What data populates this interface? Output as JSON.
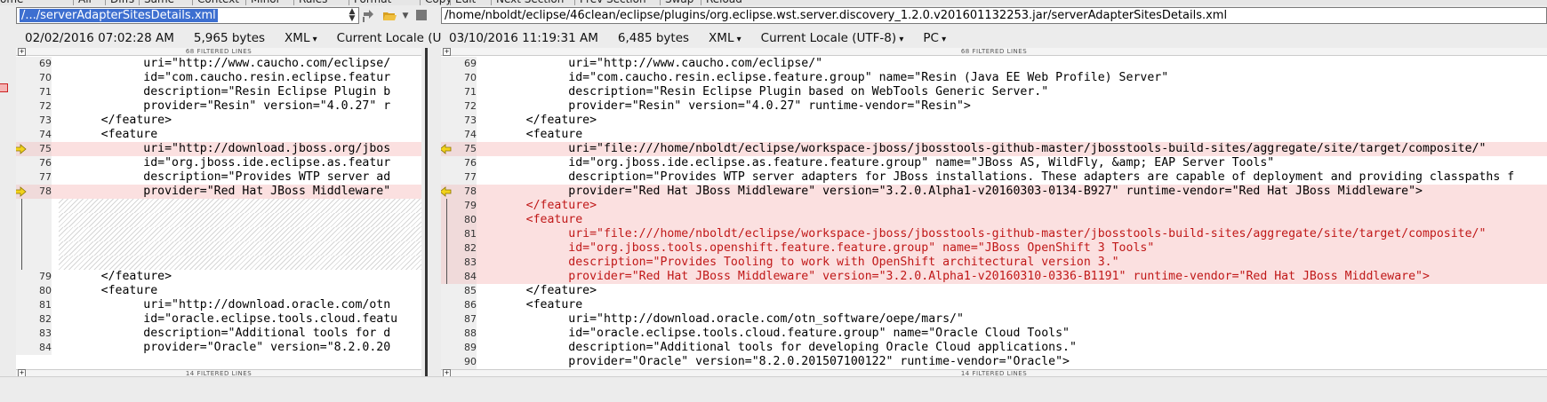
{
  "menubar": {
    "items": [
      "ome",
      "All",
      "Diffs",
      "Same",
      "Context",
      "Minor",
      "Rules",
      "Format",
      "Copy",
      "Edit",
      "Next Section",
      "Prev Section",
      "Swap",
      "Reload"
    ]
  },
  "toolbar": {
    "left_path": "/.../serverAdapterSitesDetails.xml",
    "right_path": "/home/nboldt/eclipse/46clean/eclipse/plugins/org.eclipse.wst.server.discovery_1.2.0.v201601132253.jar/serverAdapterSitesDetails.xml"
  },
  "left_status": {
    "date": "02/02/2016 07:02:28 AM",
    "size": "5,965 bytes",
    "format": "XML",
    "encoding": "Current Locale (U"
  },
  "right_status": {
    "date": "03/10/2016 11:19:31 AM",
    "size": "6,485 bytes",
    "format": "XML",
    "encoding": "Current Locale (UTF-8)",
    "line_ending": "PC"
  },
  "filtered_top": "68 FILTERED LINES",
  "filtered_bottom": "14 FILTERED LINES",
  "left_lines": [
    {
      "n": "69",
      "t": "            uri=\"http://www.caucho.com/eclipse/",
      "s": "normal"
    },
    {
      "n": "70",
      "t": "            id=\"com.caucho.resin.eclipse.featur",
      "s": "normal"
    },
    {
      "n": "71",
      "t": "            description=\"Resin Eclipse Plugin b",
      "s": "normal"
    },
    {
      "n": "72",
      "t": "            provider=\"Resin\" version=\"4.0.27\" r",
      "s": "normal"
    },
    {
      "n": "73",
      "t": "      </feature>",
      "s": "normal"
    },
    {
      "n": "74",
      "t": "      <feature",
      "s": "normal"
    },
    {
      "n": "75",
      "t": "            uri=\"http://download.jboss.org/jbos",
      "s": "changed"
    },
    {
      "n": "76",
      "t": "            id=\"org.jboss.ide.eclipse.as.featur",
      "s": "normal"
    },
    {
      "n": "77",
      "t": "            description=\"Provides WTP server ad",
      "s": "normal"
    },
    {
      "n": "78",
      "t": "            provider=\"Red Hat JBoss Middleware\"",
      "s": "changed"
    },
    {
      "n": "",
      "t": "",
      "s": "hatch"
    },
    {
      "n": "",
      "t": "",
      "s": "hatch"
    },
    {
      "n": "",
      "t": "",
      "s": "hatch"
    },
    {
      "n": "",
      "t": "",
      "s": "hatch"
    },
    {
      "n": "",
      "t": "",
      "s": "hatch"
    },
    {
      "n": "79",
      "t": "      </feature>",
      "s": "normal"
    },
    {
      "n": "80",
      "t": "      <feature",
      "s": "normal"
    },
    {
      "n": "81",
      "t": "            uri=\"http://download.oracle.com/otn",
      "s": "normal"
    },
    {
      "n": "82",
      "t": "            id=\"oracle.eclipse.tools.cloud.featu",
      "s": "normal"
    },
    {
      "n": "83",
      "t": "            description=\"Additional tools for d",
      "s": "normal"
    },
    {
      "n": "84",
      "t": "            provider=\"Oracle\" version=\"8.2.0.20",
      "s": "normal"
    }
  ],
  "right_lines": [
    {
      "n": "69",
      "t": "            uri=\"http://www.caucho.com/eclipse/\"",
      "s": "normal"
    },
    {
      "n": "70",
      "t": "            id=\"com.caucho.resin.eclipse.feature.group\" name=\"Resin (Java EE Web Profile) Server\"",
      "s": "normal"
    },
    {
      "n": "71",
      "t": "            description=\"Resin Eclipse Plugin based on WebTools Generic Server.\"",
      "s": "normal"
    },
    {
      "n": "72",
      "t": "            provider=\"Resin\" version=\"4.0.27\" runtime-vendor=\"Resin\">",
      "s": "normal"
    },
    {
      "n": "73",
      "t": "      </feature>",
      "s": "normal"
    },
    {
      "n": "74",
      "t": "      <feature",
      "s": "normal"
    },
    {
      "n": "75",
      "t": "            uri=\"file:///home/nboldt/eclipse/workspace-jboss/jbosstools-github-master/jbosstools-build-sites/aggregate/site/target/composite/\"",
      "s": "changed"
    },
    {
      "n": "76",
      "t": "            id=\"org.jboss.ide.eclipse.as.feature.feature.group\" name=\"JBoss AS, WildFly, &amp; EAP Server Tools\"",
      "s": "normal"
    },
    {
      "n": "77",
      "t": "            description=\"Provides WTP server adapters for JBoss installations. These adapters are capable of deployment and providing classpaths f",
      "s": "normal"
    },
    {
      "n": "78",
      "t": "            provider=\"Red Hat JBoss Middleware\" version=\"3.2.0.Alpha1-v20160303-0134-B927\" runtime-vendor=\"Red Hat JBoss Middleware\">",
      "s": "changed"
    },
    {
      "n": "79",
      "t": "      </feature>",
      "s": "inserted"
    },
    {
      "n": "80",
      "t": "      <feature",
      "s": "inserted"
    },
    {
      "n": "81",
      "t": "            uri=\"file:///home/nboldt/eclipse/workspace-jboss/jbosstools-github-master/jbosstools-build-sites/aggregate/site/target/composite/\"",
      "s": "inserted"
    },
    {
      "n": "82",
      "t": "            id=\"org.jboss.tools.openshift.feature.feature.group\" name=\"JBoss OpenShift 3 Tools\"",
      "s": "inserted"
    },
    {
      "n": "83",
      "t": "            description=\"Provides Tooling to work with OpenShift architectural version 3.\"",
      "s": "inserted"
    },
    {
      "n": "84",
      "t": "            provider=\"Red Hat JBoss Middleware\" version=\"3.2.0.Alpha1-v20160310-0336-B1191\" runtime-vendor=\"Red Hat JBoss Middleware\">",
      "s": "inserted"
    },
    {
      "n": "85",
      "t": "      </feature>",
      "s": "normal"
    },
    {
      "n": "86",
      "t": "      <feature",
      "s": "normal"
    },
    {
      "n": "87",
      "t": "            uri=\"http://download.oracle.com/otn_software/oepe/mars/\"",
      "s": "normal"
    },
    {
      "n": "88",
      "t": "            id=\"oracle.eclipse.tools.cloud.feature.group\" name=\"Oracle Cloud Tools\"",
      "s": "normal"
    },
    {
      "n": "89",
      "t": "            description=\"Additional tools for developing Oracle Cloud applications.\"",
      "s": "normal"
    },
    {
      "n": "90",
      "t": "            provider=\"Oracle\" version=\"8.2.0.201507100122\" runtime-vendor=\"Oracle\">",
      "s": "normal"
    }
  ],
  "colors": {
    "changed_bg": "#fbe0e0",
    "diff_text": "#c01818",
    "arrow": "#f2d21c"
  },
  "icons": [
    "swap-arrow-icon",
    "folder-open-icon",
    "stop-icon",
    "yellow-arrow-icon",
    "plus-box-icon"
  ]
}
